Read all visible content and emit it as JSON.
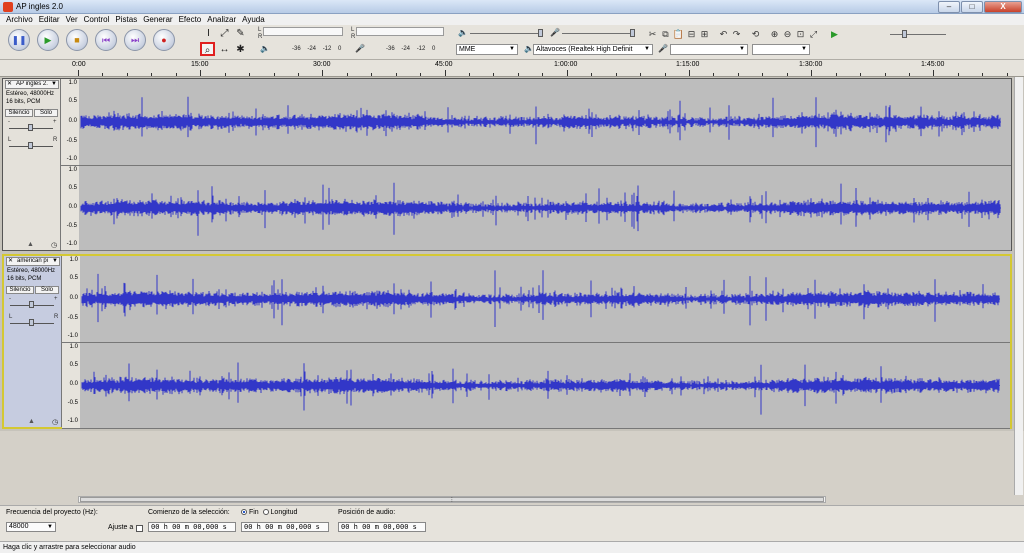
{
  "window": {
    "title": "AP ingles 2.0",
    "controls": {
      "minimize": "–",
      "maximize": "□",
      "close": "X"
    }
  },
  "menu": [
    "Archivo",
    "Editar",
    "Ver",
    "Control",
    "Pistas",
    "Generar",
    "Efecto",
    "Analizar",
    "Ayuda"
  ],
  "transport": {
    "pause": "❚❚",
    "play": "▶",
    "stop": "■",
    "skip_start": "⏮",
    "skip_end": "⏭",
    "record": "●"
  },
  "tools": {
    "selection": "I",
    "envelope": "⤢",
    "draw": "✎",
    "zoom": "⌕",
    "timeshift": "↔",
    "multi": "✱"
  },
  "meters": {
    "left_channel": "L",
    "right_channel": "R",
    "scale": [
      "-36",
      "-24",
      "-12",
      "0"
    ],
    "speaker_icon": "🔈",
    "mic_icon": "🎤"
  },
  "devices": {
    "host": "MME",
    "output": "Altavoces (Realtek High Definit",
    "input": "",
    "channels": ""
  },
  "ruler": {
    "labels": [
      "0:00",
      "15:00",
      "30:00",
      "45:00",
      "1:00:00",
      "1:15:00",
      "1:30:00",
      "1:45:00"
    ]
  },
  "tracks": [
    {
      "name": "AP ingles 2.",
      "format_line1": "Estéreo, 48000Hz",
      "format_line2": "16 bits, PCM",
      "mute": "Silencio",
      "solo": "Solo",
      "gain_minus": "-",
      "gain_plus": "+",
      "pan_left": "L",
      "pan_right": "R",
      "selected": false
    },
    {
      "name": "american pi",
      "format_line1": "Estéreo, 48000Hz",
      "format_line2": "16 bits, PCM",
      "mute": "Silencio",
      "solo": "Solo",
      "gain_minus": "-",
      "gain_plus": "+",
      "pan_left": "L",
      "pan_right": "R",
      "selected": true
    }
  ],
  "amplitude_scale": [
    "1.0",
    "0.5",
    "0.0",
    "-0.5",
    "-1.0"
  ],
  "bottom": {
    "rate_label": "Frecuencia del proyecto (Hz):",
    "rate_value": "48000",
    "snap_label": "Ajuste a",
    "selection_label": "Comienzo de la selección:",
    "end_label": "Fin",
    "length_label": "Longitud",
    "position_label": "Posición de audio:",
    "time_start": "00 h 00 m 00,000 s",
    "time_end": "00 h 00 m 00,000 s",
    "time_position": "00 h 00 m 00,000 s"
  },
  "status": "Haga clic y arrastre para seleccionar audio",
  "colors": {
    "waveform": "#3237c8",
    "wave_bg": "#bdbdbd",
    "selected_border": "#d4c832",
    "zoom_highlight": "#e02020"
  }
}
